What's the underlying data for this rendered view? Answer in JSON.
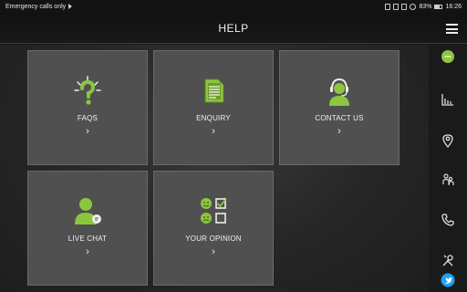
{
  "status_bar": {
    "left_text": "Emergency calls only",
    "battery": "83%",
    "time": "16:26"
  },
  "header": {
    "title": "HELP",
    "menu_icon": "hamburger-menu-icon"
  },
  "tiles": [
    {
      "label": "FAQS",
      "icon": "question-bulb-icon",
      "chevron": "›"
    },
    {
      "label": "ENQUIRY",
      "icon": "document-icon",
      "chevron": "›"
    },
    {
      "label": "CONTACT US",
      "icon": "headset-agent-icon",
      "chevron": "›"
    },
    {
      "label": "LIVE CHAT",
      "icon": "person-chat-icon",
      "chevron": "›"
    },
    {
      "label": "YOUR OPINION",
      "icon": "survey-smiley-icon",
      "chevron": "›"
    }
  ],
  "sidebar": {
    "items": [
      {
        "icon": "active-bubble-icon"
      },
      {
        "icon": "bar-chart-icon"
      },
      {
        "icon": "location-pin-icon"
      },
      {
        "icon": "people-icon"
      },
      {
        "icon": "phone-icon"
      },
      {
        "icon": "tools-icon"
      },
      {
        "icon": "twitter-icon"
      }
    ]
  },
  "colors": {
    "accent": "#8cc63f",
    "tile_bg": "#505050",
    "twitter": "#1da1f2"
  }
}
